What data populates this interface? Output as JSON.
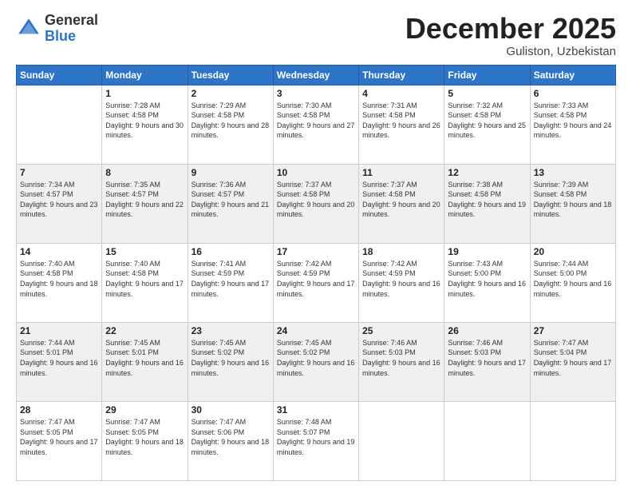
{
  "logo": {
    "general": "General",
    "blue": "Blue"
  },
  "header": {
    "month": "December 2025",
    "location": "Guliston, Uzbekistan"
  },
  "weekdays": [
    "Sunday",
    "Monday",
    "Tuesday",
    "Wednesday",
    "Thursday",
    "Friday",
    "Saturday"
  ],
  "rows": [
    [
      {
        "day": "",
        "empty": true
      },
      {
        "day": "1",
        "sunrise": "7:28 AM",
        "sunset": "4:58 PM",
        "daylight": "9 hours and 30 minutes."
      },
      {
        "day": "2",
        "sunrise": "7:29 AM",
        "sunset": "4:58 PM",
        "daylight": "9 hours and 28 minutes."
      },
      {
        "day": "3",
        "sunrise": "7:30 AM",
        "sunset": "4:58 PM",
        "daylight": "9 hours and 27 minutes."
      },
      {
        "day": "4",
        "sunrise": "7:31 AM",
        "sunset": "4:58 PM",
        "daylight": "9 hours and 26 minutes."
      },
      {
        "day": "5",
        "sunrise": "7:32 AM",
        "sunset": "4:58 PM",
        "daylight": "9 hours and 25 minutes."
      },
      {
        "day": "6",
        "sunrise": "7:33 AM",
        "sunset": "4:58 PM",
        "daylight": "9 hours and 24 minutes."
      }
    ],
    [
      {
        "day": "7",
        "sunrise": "7:34 AM",
        "sunset": "4:57 PM",
        "daylight": "9 hours and 23 minutes."
      },
      {
        "day": "8",
        "sunrise": "7:35 AM",
        "sunset": "4:57 PM",
        "daylight": "9 hours and 22 minutes."
      },
      {
        "day": "9",
        "sunrise": "7:36 AM",
        "sunset": "4:57 PM",
        "daylight": "9 hours and 21 minutes."
      },
      {
        "day": "10",
        "sunrise": "7:37 AM",
        "sunset": "4:58 PM",
        "daylight": "9 hours and 20 minutes."
      },
      {
        "day": "11",
        "sunrise": "7:37 AM",
        "sunset": "4:58 PM",
        "daylight": "9 hours and 20 minutes."
      },
      {
        "day": "12",
        "sunrise": "7:38 AM",
        "sunset": "4:58 PM",
        "daylight": "9 hours and 19 minutes."
      },
      {
        "day": "13",
        "sunrise": "7:39 AM",
        "sunset": "4:58 PM",
        "daylight": "9 hours and 18 minutes."
      }
    ],
    [
      {
        "day": "14",
        "sunrise": "7:40 AM",
        "sunset": "4:58 PM",
        "daylight": "9 hours and 18 minutes."
      },
      {
        "day": "15",
        "sunrise": "7:40 AM",
        "sunset": "4:58 PM",
        "daylight": "9 hours and 17 minutes."
      },
      {
        "day": "16",
        "sunrise": "7:41 AM",
        "sunset": "4:59 PM",
        "daylight": "9 hours and 17 minutes."
      },
      {
        "day": "17",
        "sunrise": "7:42 AM",
        "sunset": "4:59 PM",
        "daylight": "9 hours and 17 minutes."
      },
      {
        "day": "18",
        "sunrise": "7:42 AM",
        "sunset": "4:59 PM",
        "daylight": "9 hours and 16 minutes."
      },
      {
        "day": "19",
        "sunrise": "7:43 AM",
        "sunset": "5:00 PM",
        "daylight": "9 hours and 16 minutes."
      },
      {
        "day": "20",
        "sunrise": "7:44 AM",
        "sunset": "5:00 PM",
        "daylight": "9 hours and 16 minutes."
      }
    ],
    [
      {
        "day": "21",
        "sunrise": "7:44 AM",
        "sunset": "5:01 PM",
        "daylight": "9 hours and 16 minutes."
      },
      {
        "day": "22",
        "sunrise": "7:45 AM",
        "sunset": "5:01 PM",
        "daylight": "9 hours and 16 minutes."
      },
      {
        "day": "23",
        "sunrise": "7:45 AM",
        "sunset": "5:02 PM",
        "daylight": "9 hours and 16 minutes."
      },
      {
        "day": "24",
        "sunrise": "7:45 AM",
        "sunset": "5:02 PM",
        "daylight": "9 hours and 16 minutes."
      },
      {
        "day": "25",
        "sunrise": "7:46 AM",
        "sunset": "5:03 PM",
        "daylight": "9 hours and 16 minutes."
      },
      {
        "day": "26",
        "sunrise": "7:46 AM",
        "sunset": "5:03 PM",
        "daylight": "9 hours and 17 minutes."
      },
      {
        "day": "27",
        "sunrise": "7:47 AM",
        "sunset": "5:04 PM",
        "daylight": "9 hours and 17 minutes."
      }
    ],
    [
      {
        "day": "28",
        "sunrise": "7:47 AM",
        "sunset": "5:05 PM",
        "daylight": "9 hours and 17 minutes."
      },
      {
        "day": "29",
        "sunrise": "7:47 AM",
        "sunset": "5:05 PM",
        "daylight": "9 hours and 18 minutes."
      },
      {
        "day": "30",
        "sunrise": "7:47 AM",
        "sunset": "5:06 PM",
        "daylight": "9 hours and 18 minutes."
      },
      {
        "day": "31",
        "sunrise": "7:48 AM",
        "sunset": "5:07 PM",
        "daylight": "9 hours and 19 minutes."
      },
      {
        "day": "",
        "empty": true
      },
      {
        "day": "",
        "empty": true
      },
      {
        "day": "",
        "empty": true
      }
    ]
  ]
}
